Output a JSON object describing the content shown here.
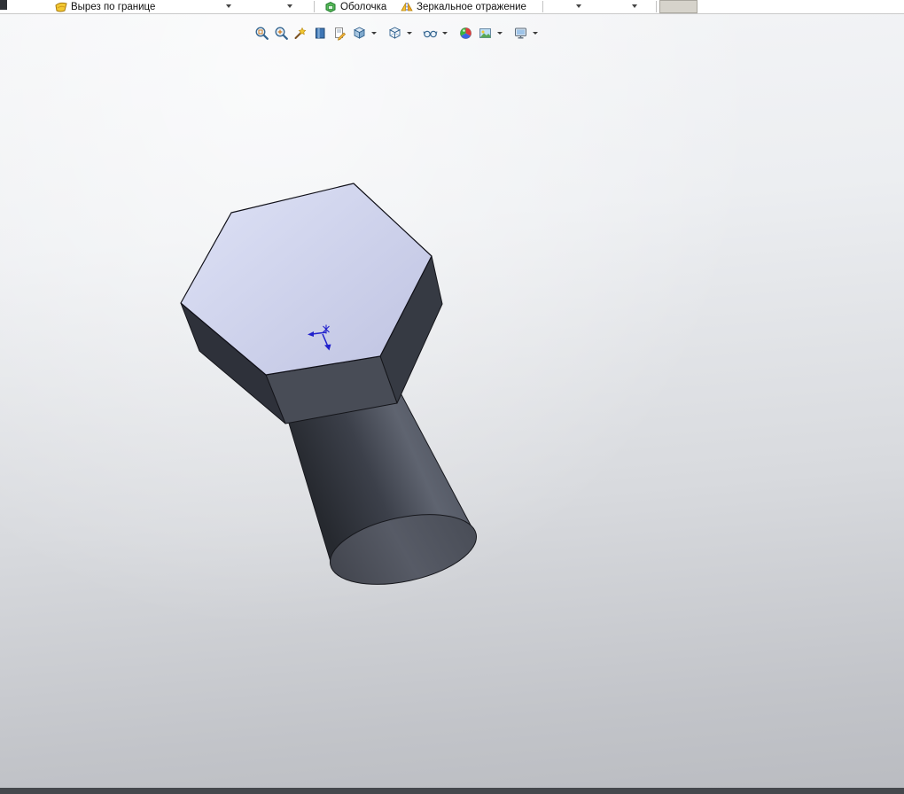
{
  "ribbon": {
    "items": [
      {
        "label": "Вырез по границе",
        "icon": "boundary-cut-icon"
      },
      {
        "label": "Оболочка",
        "icon": "shell-icon"
      },
      {
        "label": "Зеркальное отражение",
        "icon": "mirror-icon"
      }
    ]
  },
  "heads_up_toolbar": {
    "icons": [
      "zoom-to-fit-icon",
      "zoom-to-area-icon",
      "previous-view-icon",
      "section-view-icon",
      "annotation-view-icon",
      "view-orientation-icon",
      "display-style-icon",
      "hide-show-items-icon",
      "edit-appearance-icon",
      "apply-scene-icon",
      "view-settings-icon"
    ],
    "icons_with_dropdown": [
      "view-orientation-icon",
      "display-style-icon",
      "hide-show-items-icon",
      "apply-scene-icon",
      "view-settings-icon"
    ]
  },
  "viewport": {
    "selection": "top hexagonal face highlighted",
    "colors": {
      "selected_face": "#ccd0ea",
      "head_side_dark": "#363a43",
      "head_side_mid": "#484c56",
      "head_side_darkest": "#2e313a",
      "shank_highlight": "#5f6470",
      "origin_marker": "#2020cc",
      "background_top": "#f4f5f7",
      "background_bottom": "#babcc1"
    }
  }
}
